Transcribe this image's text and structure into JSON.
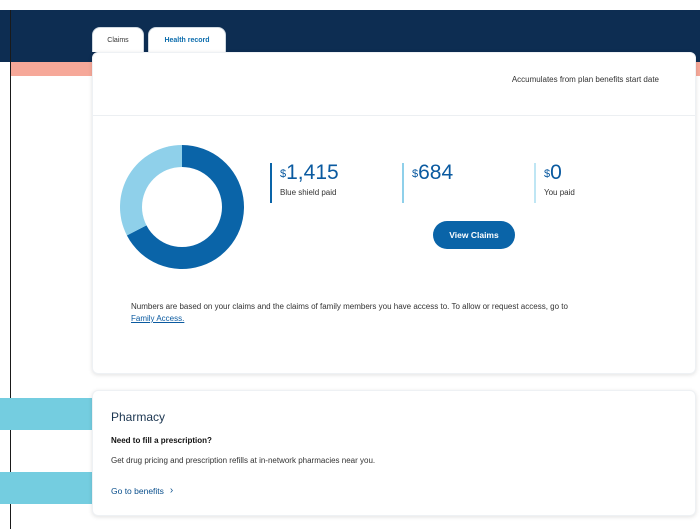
{
  "tabs": [
    {
      "label": "Claims"
    },
    {
      "label": "Health record"
    }
  ],
  "claims_card": {
    "accumulates_text": "Accumulates from plan benefits start date",
    "stats": [
      {
        "currency": "$",
        "amount": "1,415",
        "label": "Blue shield paid",
        "color": "#0a64a8"
      },
      {
        "currency": "$",
        "amount": "684",
        "label": "",
        "color": "#8fd0ea"
      },
      {
        "currency": "$",
        "amount": "0",
        "label": "You paid",
        "color": "#bfe6f4"
      }
    ],
    "donut": {
      "blue_shield_paid": 1415,
      "other": 684,
      "you_paid": 0
    },
    "view_claims_label": "View Claims",
    "note_text": "Numbers are based on your claims and the claims of family members you have access to. To allow or request access, go to",
    "family_access_link": "Family Access."
  },
  "pharmacy": {
    "title": "Pharmacy",
    "question": "Need to fill a prescription?",
    "description": "Get drug pricing and prescription refills at in-network pharmacies near you.",
    "link_label": "Go to benefits"
  },
  "colors": {
    "header": "#0d2d52",
    "accent": "#f6a899",
    "primary": "#0a64a8",
    "pill": "#74cde0"
  }
}
